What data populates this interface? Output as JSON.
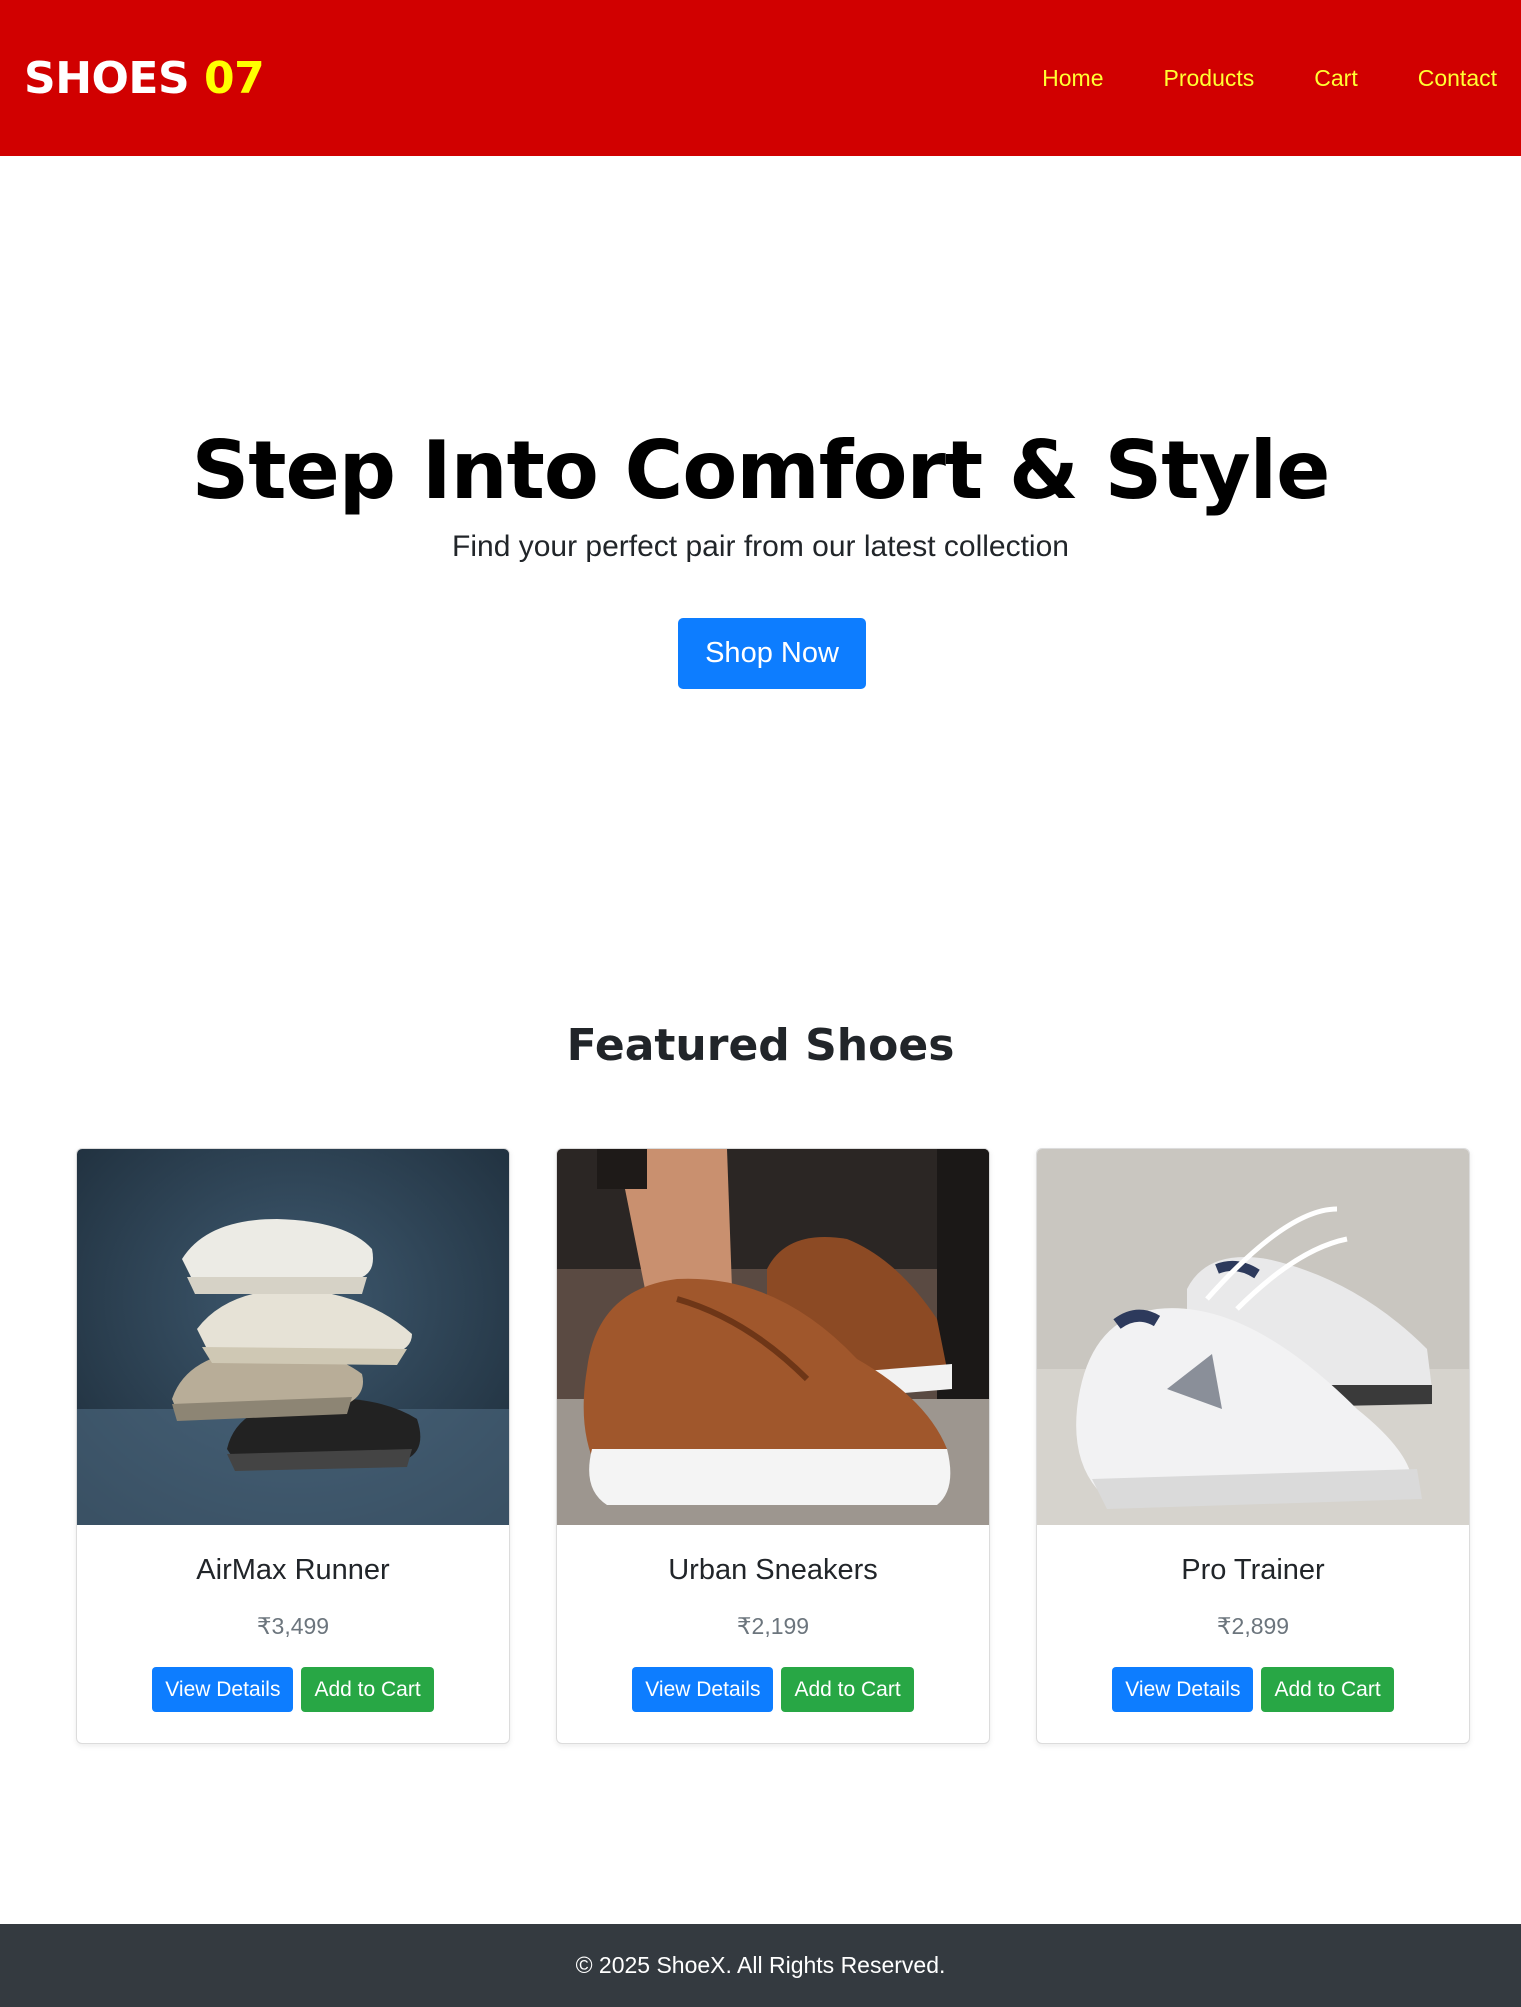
{
  "navbar": {
    "brand_text": "SHOES",
    "brand_number": "07",
    "links": [
      {
        "label": "Home"
      },
      {
        "label": "Products"
      },
      {
        "label": "Cart"
      },
      {
        "label": "Contact"
      }
    ],
    "colors": {
      "background": "#d10000",
      "link": "#ffff33",
      "brand_number": "#ffff00"
    }
  },
  "hero": {
    "title": "Step Into Comfort & Style",
    "subtitle": "Find your perfect pair from our latest collection",
    "cta_label": "Shop Now"
  },
  "featured": {
    "title": "Featured Shoes",
    "products": [
      {
        "name": "AirMax Runner",
        "price": "₹3,499",
        "image": "stacked-running-shoes-photo",
        "view_label": "View Details",
        "cart_label": "Add to Cart"
      },
      {
        "name": "Urban Sneakers",
        "price": "₹2,199",
        "image": "brown-leather-sneakers-photo",
        "view_label": "View Details",
        "cart_label": "Add to Cart"
      },
      {
        "name": "Pro Trainer",
        "price": "₹2,899",
        "image": "white-trainer-shoes-photo",
        "view_label": "View Details",
        "cart_label": "Add to Cart"
      }
    ]
  },
  "footer": {
    "text": "© 2025 ShoeX. All Rights Reserved."
  },
  "colors": {
    "primary": "#0d7dff",
    "success": "#28a745",
    "footer": "#343a40"
  }
}
